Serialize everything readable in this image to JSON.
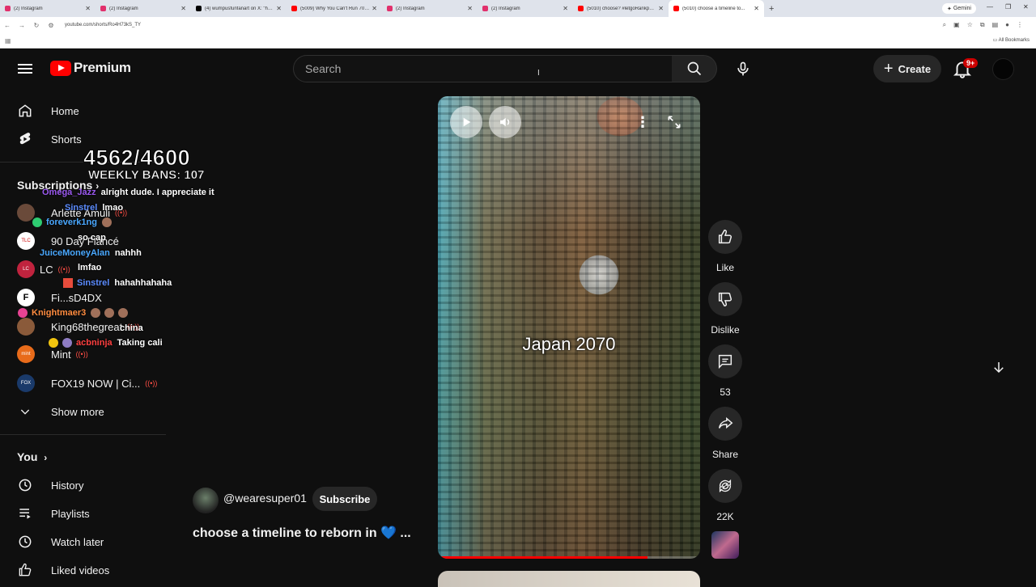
{
  "browser": {
    "tabs": [
      {
        "label": "(2) Instagram",
        "color": "#e1306c"
      },
      {
        "label": "(2) Instagram",
        "color": "#e1306c"
      },
      {
        "label": "(4) wumpusfunfanart on X: \"he...",
        "color": "#000000"
      },
      {
        "label": "(5009) Why You Can't Run 70 I...",
        "color": "#ff0000"
      },
      {
        "label": "(2) Instagram",
        "color": "#e1306c"
      },
      {
        "label": "(2) Instagram",
        "color": "#e1306c"
      },
      {
        "label": "(5010) choose? #letgoRankpeto...",
        "color": "#ff0000"
      },
      {
        "label": "(5010) choose a timeline to...",
        "color": "#ff0000"
      }
    ],
    "gemini_label": "Gemini",
    "url": "youtube.com/shorts/Ro4H73kS_TY",
    "all_bookmarks": "All Bookmarks"
  },
  "header": {
    "brand": "Premium",
    "search_placeholder": "Search",
    "create_label": "Create",
    "notifications_badge": "9+"
  },
  "sidebar": {
    "home": "Home",
    "shorts": "Shorts",
    "subscriptions_heading": "Subscriptions",
    "subscriptions": [
      {
        "name": "Arlette Amuli",
        "avatar_color": "#6a4a3a",
        "live": true
      },
      {
        "name": "90 Day Fiancé",
        "avatar_color": "#ffffff",
        "live": false
      },
      {
        "name": "LC",
        "avatar_color": "#c0233e",
        "live": true
      },
      {
        "name": "Fi...sD4DX",
        "avatar_color": "#ffffff",
        "live": false
      },
      {
        "name": "King68thegreat",
        "avatar_color": "#8a5a3a",
        "live": true
      },
      {
        "name": "Mint",
        "avatar_color": "#e86b1a",
        "live": true
      },
      {
        "name": "FOX19 NOW | Ci...",
        "avatar_color": "#1a3a6a",
        "live": true
      }
    ],
    "show_more": "Show more",
    "you_heading": "You",
    "history": "History",
    "playlists": "Playlists",
    "watch_later": "Watch later",
    "liked_videos": "Liked videos"
  },
  "overlay": {
    "counter": "4562/4600",
    "weekly_bans": "WEEKLY BANS: 107",
    "chat": [
      {
        "user": "Omega_Jazz",
        "color": "#9b59f0",
        "msg": "alright dude. I appreciate it"
      },
      {
        "user": "Sinstrel",
        "color": "#5c8cff",
        "msg": "lmao"
      },
      {
        "user": "foreverk1ng",
        "color": "#4aa8ff",
        "msg": ""
      },
      {
        "user": "",
        "color": "#ff4040",
        "msg": "so cap"
      },
      {
        "user": "JuiceMoneyAlan",
        "color": "#4aa8ff",
        "msg": "nahhh"
      },
      {
        "user": "",
        "color": "#2244ff",
        "msg": "lmfao"
      },
      {
        "user": "Sinstrel",
        "color": "#5c8cff",
        "msg": "hahahhahaha"
      },
      {
        "user": "Knightmaer3",
        "color": "#ff8c40",
        "msg": ""
      },
      {
        "user": "",
        "color": "#4aa8ff",
        "msg": "china"
      },
      {
        "user": "acbninja",
        "color": "#ff4040",
        "msg": "Taking cali"
      }
    ]
  },
  "short": {
    "overlay_title": "Japan 2070",
    "progress": 0.8,
    "channel": "@wearesuper01",
    "subscribe": "Subscribe",
    "caption": "choose a timeline to reborn in 💙 ..."
  },
  "actions": {
    "like": "Like",
    "dislike": "Dislike",
    "comments": "53",
    "share": "Share",
    "remix": "22K"
  }
}
